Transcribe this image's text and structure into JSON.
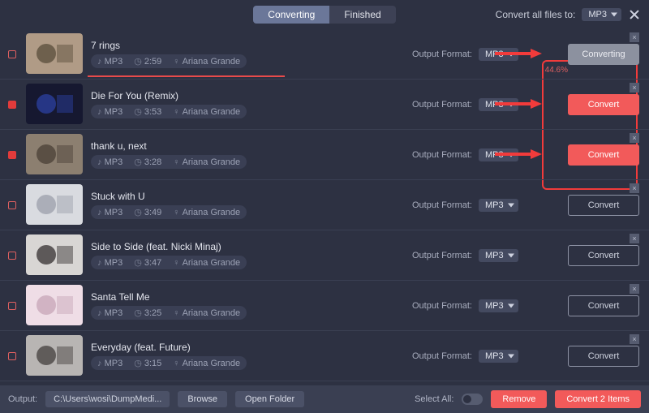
{
  "header": {
    "tabs": {
      "converting": "Converting",
      "finished": "Finished",
      "active": 0
    },
    "convert_all_label": "Convert all files to:",
    "convert_all_format": "MP3"
  },
  "common": {
    "output_format_label": "Output Format:",
    "format_icon": "♪",
    "time_icon": "⏱",
    "artist_icon": "♀"
  },
  "tracks": [
    {
      "title": "7 rings",
      "format": "MP3",
      "duration": "2:59",
      "artist": "Ariana Grande",
      "out_format": "MP3",
      "btn_label": "Converting",
      "btn_style": "gray-filled",
      "checked": false,
      "progress_pct": 44,
      "progress_text": "44.6%",
      "arrow": true
    },
    {
      "title": "Die For You (Remix)",
      "format": "MP3",
      "duration": "3:53",
      "artist": "Ariana Grande",
      "out_format": "MP3",
      "btn_label": "Convert",
      "btn_style": "red",
      "checked": true,
      "arrow": true
    },
    {
      "title": "thank u, next",
      "format": "MP3",
      "duration": "3:28",
      "artist": "Ariana Grande",
      "out_format": "MP3",
      "btn_label": "Convert",
      "btn_style": "red",
      "checked": true,
      "arrow": true
    },
    {
      "title": "Stuck with U",
      "format": "MP3",
      "duration": "3:49",
      "artist": "Ariana Grande",
      "out_format": "MP3",
      "btn_label": "Convert",
      "btn_style": "ghost",
      "checked": false
    },
    {
      "title": "Side to Side (feat. Nicki Minaj)",
      "format": "MP3",
      "duration": "3:47",
      "artist": "Ariana Grande",
      "out_format": "MP3",
      "btn_label": "Convert",
      "btn_style": "ghost",
      "checked": false
    },
    {
      "title": "Santa Tell Me",
      "format": "MP3",
      "duration": "3:25",
      "artist": "Ariana Grande",
      "out_format": "MP3",
      "btn_label": "Convert",
      "btn_style": "ghost",
      "checked": false
    },
    {
      "title": "Everyday (feat. Future)",
      "format": "MP3",
      "duration": "3:15",
      "artist": "Ariana Grande",
      "out_format": "MP3",
      "btn_label": "Convert",
      "btn_style": "ghost",
      "checked": false
    }
  ],
  "footer": {
    "output_label": "Output:",
    "output_path": "C:\\Users\\wosi\\DumpMedi...",
    "browse": "Browse",
    "open_folder": "Open Folder",
    "select_all": "Select All:",
    "remove": "Remove",
    "convert_n": "Convert 2 Items"
  },
  "thumbs": [
    {
      "bg": "#b09b86",
      "fg": "#5e513e"
    },
    {
      "bg": "#161830",
      "fg": "#2a3e9b"
    },
    {
      "bg": "#8c7f70",
      "fg": "#4d443a"
    },
    {
      "bg": "#d9dbe0",
      "fg": "#9fa3ae"
    },
    {
      "bg": "#d8d6d4",
      "fg": "#3e3a39"
    },
    {
      "bg": "#efdde6",
      "fg": "#c9a9ba"
    },
    {
      "bg": "#b8b5b3",
      "fg": "#4a4644"
    }
  ]
}
